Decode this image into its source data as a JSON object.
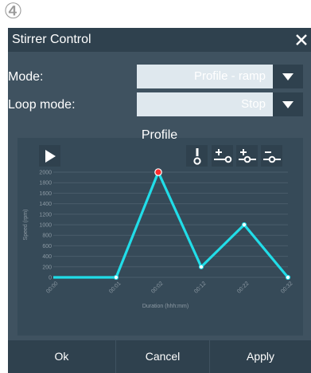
{
  "step_badge": "④",
  "dialog": {
    "title": "Stirrer Control",
    "close_icon": "close-icon"
  },
  "fields": {
    "mode": {
      "label": "Mode:",
      "value": "Profile - ramp"
    },
    "loop_mode": {
      "label": "Loop mode:",
      "value": "Stop"
    }
  },
  "profile": {
    "title": "Profile",
    "tools": [
      "play-icon",
      "alert-point-icon",
      "add-point-end-icon",
      "add-point-after-icon",
      "remove-point-icon"
    ]
  },
  "chart_data": {
    "type": "line",
    "x": [
      "00:00",
      "00:01",
      "00:02",
      "00:12",
      "00:22",
      "00:32"
    ],
    "y": [
      0,
      0,
      2000,
      200,
      1000,
      0
    ],
    "xlabel": "Duration (hhh:mm)",
    "ylabel": "Speed (rpm)",
    "yticks": [
      0,
      200,
      400,
      600,
      800,
      1000,
      1200,
      1400,
      1600,
      1800,
      2000
    ],
    "ylim": [
      0,
      2000
    ],
    "grid": true,
    "selected_index": 2,
    "colors": {
      "line": "#21dde8",
      "selected": "#ff2b2b",
      "point_fill": "#ffffff"
    }
  },
  "footer": {
    "ok": "Ok",
    "cancel": "Cancel",
    "apply": "Apply"
  }
}
